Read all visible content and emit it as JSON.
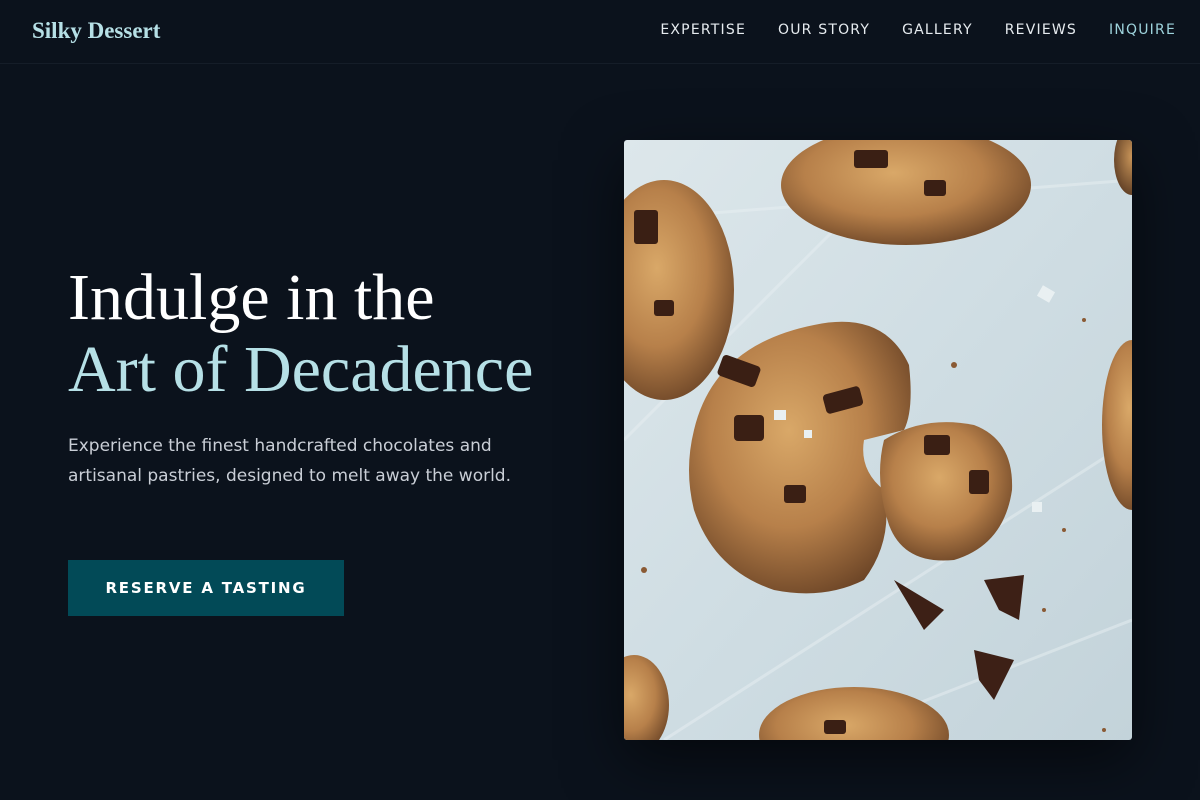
{
  "brand": {
    "name": "Silky Dessert"
  },
  "nav": {
    "items": [
      {
        "label": "EXPERTISE"
      },
      {
        "label": "OUR STORY"
      },
      {
        "label": "GALLERY"
      },
      {
        "label": "REVIEWS"
      },
      {
        "label": "INQUIRE"
      }
    ]
  },
  "hero": {
    "title_line1": "Indulge in the",
    "title_line2": "Art of Decadence",
    "subtitle": "Experience the finest handcrafted chocolates and artisanal pastries, designed to melt away the world.",
    "cta_label": "RESERVE A TASTING"
  },
  "colors": {
    "background": "#0b121c",
    "accent": "#b6e0e6",
    "button": "#024a57",
    "text": "#ffffff",
    "muted_text": "#c9ced6"
  },
  "image": {
    "subject": "chocolate-chip-cookies-photo"
  }
}
